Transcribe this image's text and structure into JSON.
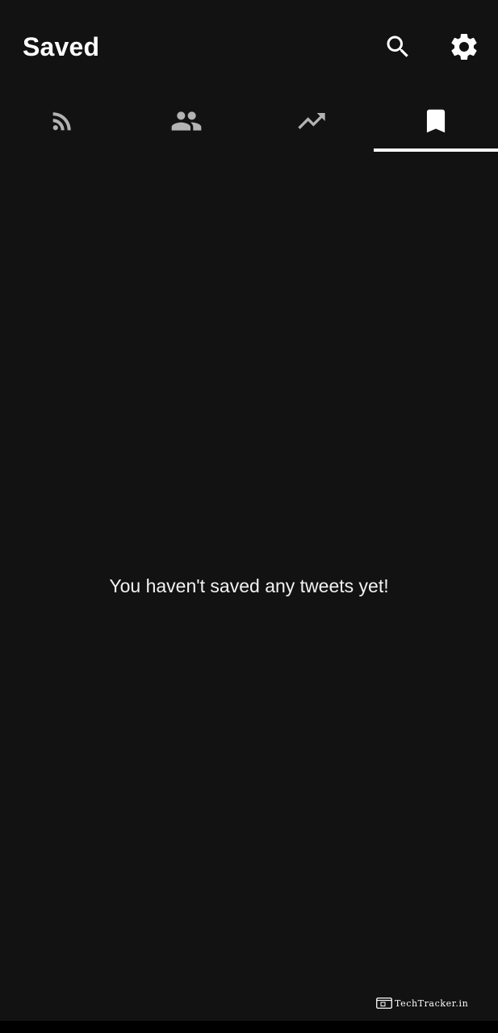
{
  "header": {
    "title": "Saved",
    "actions": [
      {
        "icon": "search-icon"
      },
      {
        "icon": "settings-icon"
      }
    ]
  },
  "tabs": [
    {
      "icon": "rss-feed-icon",
      "active": false
    },
    {
      "icon": "people-icon",
      "active": false
    },
    {
      "icon": "trending-up-icon",
      "active": false
    },
    {
      "icon": "bookmark-icon",
      "active": true
    }
  ],
  "main": {
    "empty_message": "You haven't saved any tweets yet!"
  },
  "watermark": {
    "text": "TechTracker.in"
  },
  "colors": {
    "background": "#121212",
    "text": "#ffffff",
    "inactive_icon": "#b3b3b3",
    "active_indicator": "#ffffff"
  }
}
